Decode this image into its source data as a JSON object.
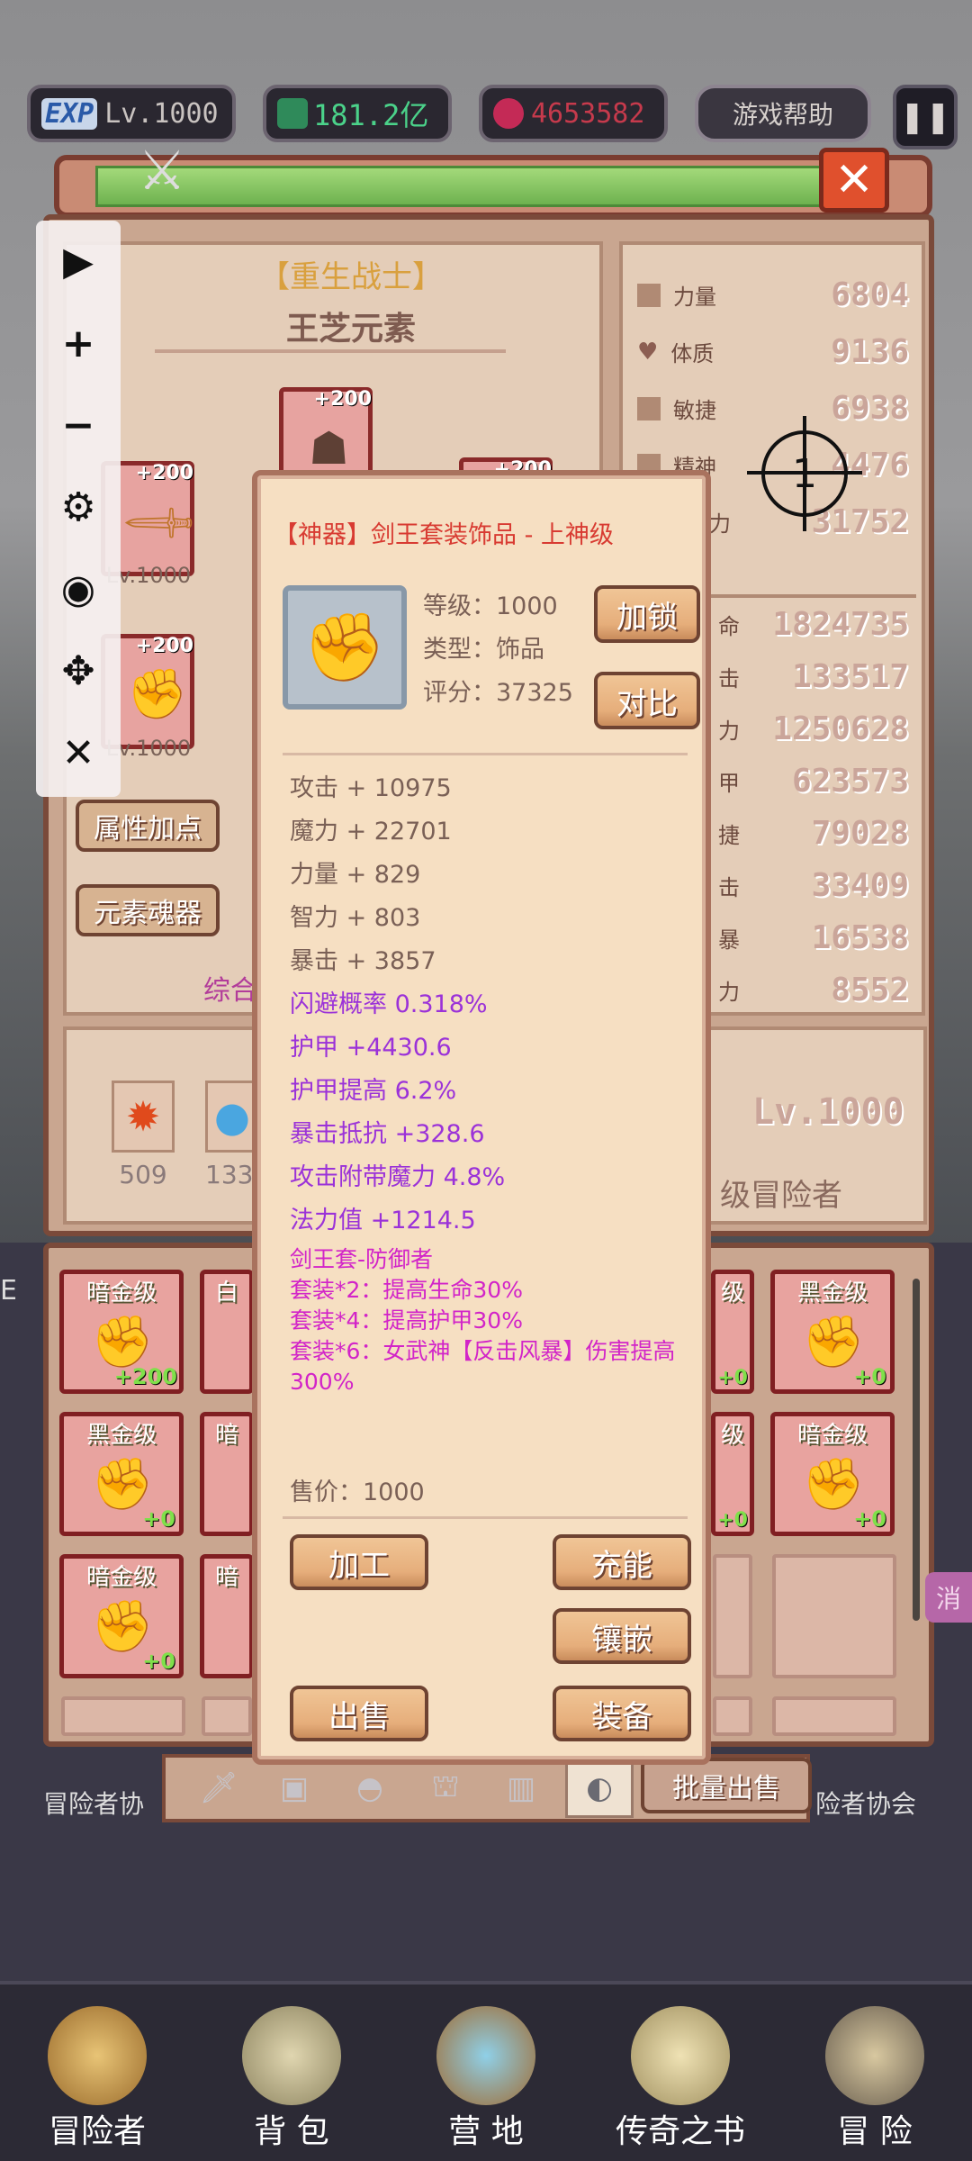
{
  "hud": {
    "exp_badge": "EXP",
    "level": "Lv.1000",
    "gold": "181.2亿",
    "gems": "4653582",
    "help_label": "游戏帮助",
    "pause_icon": "pause-icon"
  },
  "hero": {
    "title": "【重生战士】",
    "name": "王芝元素",
    "slots": [
      {
        "plus": "+200",
        "level": "Lv.1000"
      },
      {
        "plus": "+200",
        "level": "Lv.1000"
      },
      {
        "plus": "+200",
        "level": ""
      },
      {
        "plus": "+200",
        "level": ""
      }
    ],
    "attr_button": "属性加点",
    "soul_button": "元素魂器",
    "combined_partial": "综合",
    "resources": [
      {
        "value": "509"
      },
      {
        "value": "133"
      }
    ],
    "rank_level": "Lv.1000",
    "rank_title": "级冒险者"
  },
  "stats": {
    "primary": [
      {
        "label": "力量",
        "value": "6804"
      },
      {
        "label": "体质",
        "value": "9136"
      },
      {
        "label": "敏捷",
        "value": "6938"
      },
      {
        "label": "精神",
        "value": "4476"
      },
      {
        "label": "力",
        "value": "31752"
      }
    ],
    "secondary": [
      {
        "label": "命",
        "value": "1824735"
      },
      {
        "label": "击",
        "value": "133517"
      },
      {
        "label": "力",
        "value": "1250628"
      },
      {
        "label": "甲",
        "value": "623573"
      },
      {
        "label": "捷",
        "value": "79028"
      },
      {
        "label": "击",
        "value": "33409"
      },
      {
        "label": "暴",
        "value": "16538"
      },
      {
        "label": "力",
        "value": "8552"
      }
    ]
  },
  "toolbar": {
    "play": "▶",
    "plus": "+",
    "minus": "−",
    "gear": "⚙",
    "hide": "◉",
    "move": "✥",
    "close": "✕"
  },
  "crosshair_number": "1",
  "popup": {
    "title": "【神器】剑王套装饰品 - 上神级",
    "level_label": "等级：1000",
    "type_label": "类型：饰品",
    "score_label": "评分：37325",
    "lock_button": "加锁",
    "compare_button": "对比",
    "base_stats": [
      "攻击 + 10975",
      "魔力 + 22701",
      "力量 + 829",
      "智力 + 803",
      "暴击 + 3857"
    ],
    "extra_stats": [
      "闪避概率 0.318%",
      "护甲 +4430.6",
      "护甲提高 6.2%",
      "暴击抵抗 +328.6",
      "攻击附带魔力 4.8%",
      "法力值 +1214.5"
    ],
    "set_name": "剑王套-防御者",
    "set_bonuses": [
      "套装*2：提高生命30%",
      "套装*4：提高护甲30%",
      "套装*6：女武神【反击风暴】伤害提高300%"
    ],
    "price": "售价：1000",
    "btn_process": "加工",
    "btn_charge": "充能",
    "btn_inlay": "镶嵌",
    "btn_sell": "出售",
    "btn_equip": "装备"
  },
  "inventory": {
    "left_items": [
      {
        "tier": "暗金级",
        "plus": "+200"
      },
      {
        "tier": "白",
        "plus": ""
      },
      {
        "tier": "黑金级",
        "plus": "+0"
      },
      {
        "tier": "暗",
        "plus": ""
      },
      {
        "tier": "暗金级",
        "plus": "+0"
      },
      {
        "tier": "暗",
        "plus": ""
      }
    ],
    "right_items": [
      {
        "tier": "级",
        "plus": "+0"
      },
      {
        "tier": "黑金级",
        "plus": "+0"
      },
      {
        "tier": "级",
        "plus": "+0"
      },
      {
        "tier": "暗金级",
        "plus": "+0"
      }
    ],
    "bulk_sell": "批量出售",
    "side_left": "冒险者协",
    "side_right": "险者协会",
    "side_tag": "消",
    "left_edge_text": "E"
  },
  "nav": [
    {
      "label": "冒险者",
      "icon": "helmet-icon"
    },
    {
      "label": "背 包",
      "icon": "backpack-icon"
    },
    {
      "label": "营 地",
      "icon": "banner-icon"
    },
    {
      "label": "传奇之书",
      "icon": "book-icon"
    },
    {
      "label": "冒 险",
      "icon": "sword-icon"
    }
  ],
  "colors": {
    "accent_red": "#d83b32",
    "purple": "#9b32d8",
    "magenta": "#d224c8",
    "brown": "#6e4332"
  }
}
